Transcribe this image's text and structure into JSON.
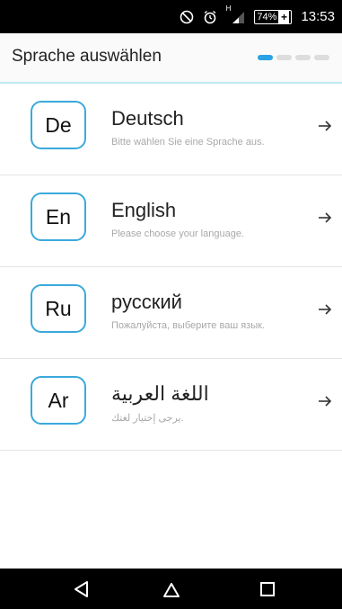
{
  "status_bar": {
    "signal_label": "H",
    "battery_percent": "74%",
    "time": "13:53",
    "icons": [
      "do-not-disturb-icon",
      "alarm-icon",
      "signal-icon",
      "battery-charging-icon"
    ]
  },
  "header": {
    "title": "Sprache auswählen",
    "steps_total": 4,
    "steps_active": 1,
    "accent_color": "#29a3e4"
  },
  "languages": [
    {
      "code": "De",
      "name": "Deutsch",
      "subtitle": "Bitte wählen Sie eine Sprache aus."
    },
    {
      "code": "En",
      "name": "English",
      "subtitle": "Please choose your language."
    },
    {
      "code": "Ru",
      "name": "русский",
      "subtitle": "Пожалуйста, выберите ваш язык."
    },
    {
      "code": "Ar",
      "name": "اللغة العربية",
      "subtitle": "يرجى إختيار لغتك."
    }
  ],
  "nav_bar": {
    "icons": [
      "back-icon",
      "home-icon",
      "recents-icon"
    ]
  }
}
